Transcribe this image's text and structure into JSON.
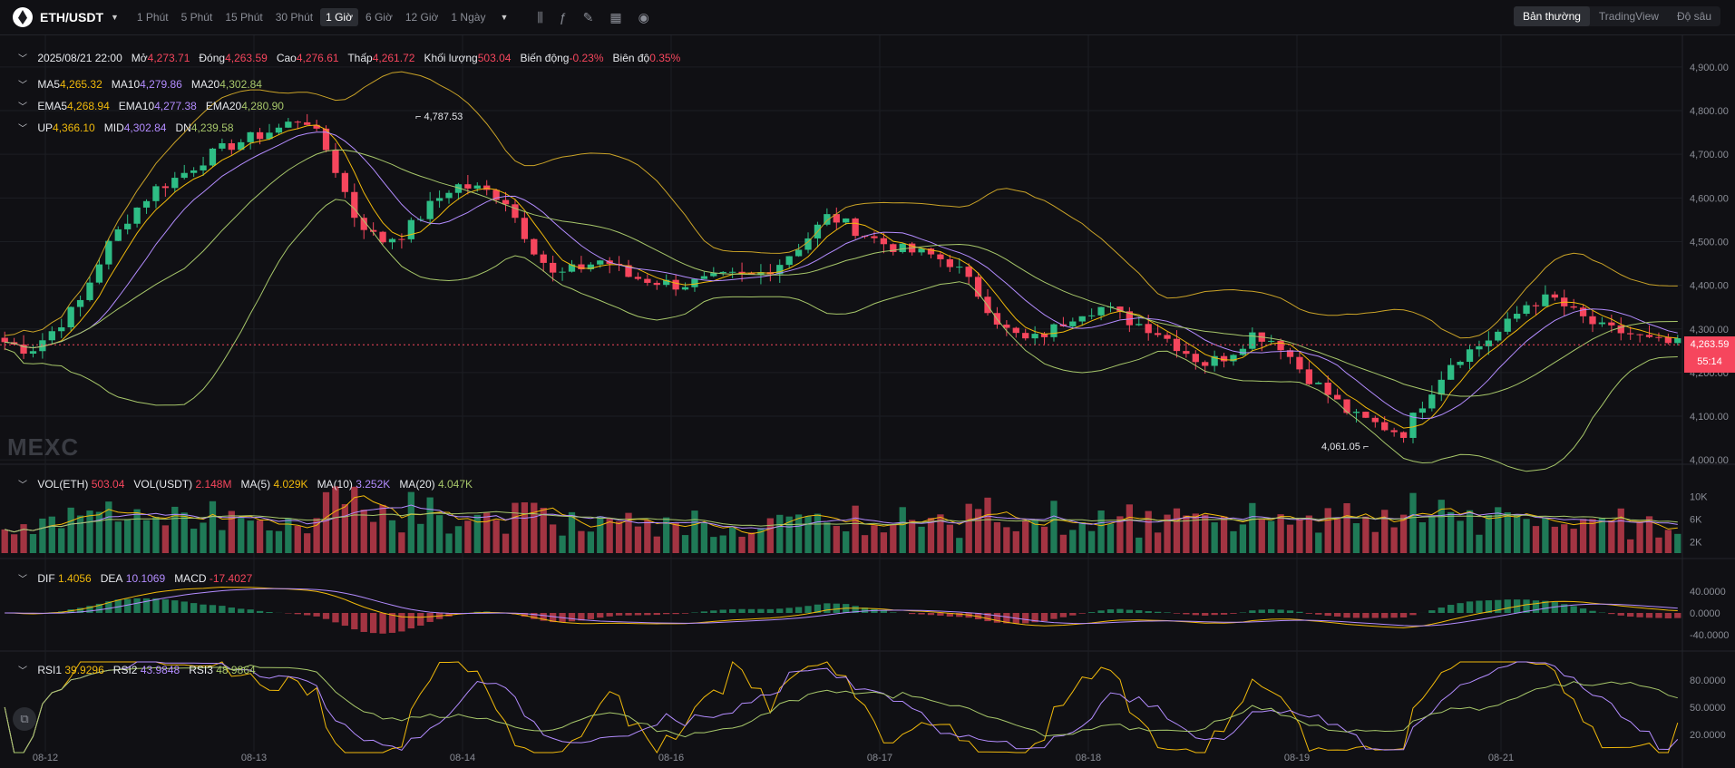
{
  "header": {
    "pair": "ETH/USDT",
    "timeframes": [
      "1 Phút",
      "5 Phút",
      "15 Phút",
      "30 Phút",
      "1 Giờ",
      "6 Giờ",
      "12 Giờ",
      "1 Ngày"
    ],
    "active_timeframe": "1 Giờ",
    "modes": [
      "Bản thường",
      "TradingView",
      "Độ sâu"
    ],
    "active_mode": "Bản thường"
  },
  "ohlc": {
    "date": "2025/08/21 22:00",
    "open_label": "Mở",
    "open": "4,273.71",
    "close_label": "Đóng",
    "close": "4,263.59",
    "high_label": "Cao",
    "high": "4,276.61",
    "low_label": "Thấp",
    "low": "4,261.72",
    "volume_label": "Khối lượng",
    "volume": "503.04",
    "change_label": "Biến động",
    "change": "-0.23%",
    "amplitude_label": "Biên độ",
    "amplitude": "0.35%"
  },
  "ma": {
    "ma5_label": "MA5",
    "ma5": "4,265.32",
    "ma10_label": "MA10",
    "ma10": "4,279.86",
    "ma20_label": "MA20",
    "ma20": "4,302.84"
  },
  "ema": {
    "ema5_label": "EMA5",
    "ema5": "4,268.94",
    "ema10_label": "EMA10",
    "ema10": "4,277.38",
    "ema20_label": "EMA20",
    "ema20": "4,280.90"
  },
  "boll": {
    "up_label": "UP",
    "up": "4,366.10",
    "mid_label": "MID",
    "mid": "4,302.84",
    "dn_label": "DN",
    "dn": "4,239.58"
  },
  "vol": {
    "eth_label": "VOL(ETH)",
    "eth": "503.04",
    "usdt_label": "VOL(USDT)",
    "usdt": "2.148M",
    "ma5_label": "MA(5)",
    "ma5": "4.029K",
    "ma10_label": "MA(10)",
    "ma10": "3.252K",
    "ma20_label": "MA(20)",
    "ma20": "4.047K"
  },
  "macd": {
    "dif_label": "DIF",
    "dif": "1.4056",
    "dea_label": "DEA",
    "dea": "10.1069",
    "macd_label": "MACD",
    "macd": "-17.4027"
  },
  "rsi": {
    "rsi1_label": "RSI1",
    "rsi1": "39.9296",
    "rsi2_label": "RSI2",
    "rsi2": "43.9848",
    "rsi3_label": "RSI3",
    "rsi3": "48.9864"
  },
  "price_axis": [
    "4,900.00",
    "4,800.00",
    "4,700.00",
    "4,600.00",
    "4,500.00",
    "4,400.00",
    "4,300.00",
    "4,200.00",
    "4,100.00",
    "4,000.00"
  ],
  "vol_axis": [
    "10K",
    "6K",
    "2K"
  ],
  "macd_axis": [
    "40.0000",
    "0.0000",
    "-40.0000"
  ],
  "rsi_axis": [
    "80.0000",
    "50.0000",
    "20.0000"
  ],
  "current_price": "4,263.59",
  "countdown": "55:14",
  "max_label": "4,787.53",
  "min_label": "4,061.05",
  "watermark": "MEXC",
  "colors": {
    "up": "#2ebd85",
    "down": "#f6465d",
    "ma5": "#f0b90b",
    "ma10": "#b38cff",
    "ma20": "#7d8b3a",
    "boll": "#c9a227"
  },
  "chart_data": {
    "type": "candlestick",
    "x_labels": [
      "08-12",
      "08-13",
      "08-14",
      "08-16",
      "08-17",
      "08-18",
      "08-19",
      "08-21"
    ],
    "close_path": [
      4270,
      4250,
      4300,
      4360,
      4480,
      4560,
      4620,
      4650,
      4690,
      4720,
      4740,
      4760,
      4787,
      4700,
      4560,
      4500,
      4520,
      4580,
      4630,
      4620,
      4600,
      4500,
      4420,
      4440,
      4460,
      4420,
      4410,
      4400,
      4410,
      4420,
      4420,
      4450,
      4500,
      4560,
      4530,
      4500,
      4480,
      4470,
      4450,
      4380,
      4300,
      4270,
      4300,
      4340,
      4350,
      4320,
      4300,
      4260,
      4220,
      4240,
      4290,
      4270,
      4200,
      4150,
      4100,
      4080,
      4061,
      4150,
      4230,
      4260,
      4300,
      4360,
      4370,
      4330,
      4300,
      4290,
      4270,
      4264
    ],
    "ylim": [
      3990,
      4960
    ],
    "volume_ylim": [
      0,
      12000
    ],
    "macd_ylim": [
      -60,
      60
    ],
    "rsi_ylim": [
      10,
      90
    ]
  }
}
